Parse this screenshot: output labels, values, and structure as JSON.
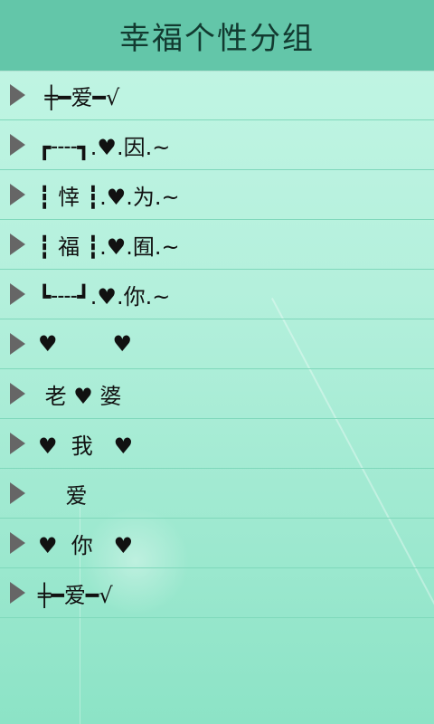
{
  "header": {
    "title": "幸福个性分组"
  },
  "groups": [
    {
      "label": " ╪━爱━√"
    },
    {
      "label": "┏╌╌┓.♥.因.~"
    },
    {
      "label": "┇ 悻 ┇.♥.为.~"
    },
    {
      "label": "┇ 福 ┇.♥.囿.~"
    },
    {
      "label": "┗╌╌┛.♥.你.~"
    },
    {
      "label": "♥        ♥"
    },
    {
      "label": " 老 ♥ 婆"
    },
    {
      "label": "♥  我   ♥"
    },
    {
      "label": "    爱"
    },
    {
      "label": "♥  你   ♥"
    },
    {
      "label": "╪━爱━√"
    }
  ],
  "icons": {
    "expand": "triangle-right-icon"
  },
  "colors": {
    "header_bg": "#63c6a9",
    "list_bg": "#b4f0dc",
    "divider": "#7fd8bb",
    "arrow": "#666666"
  }
}
